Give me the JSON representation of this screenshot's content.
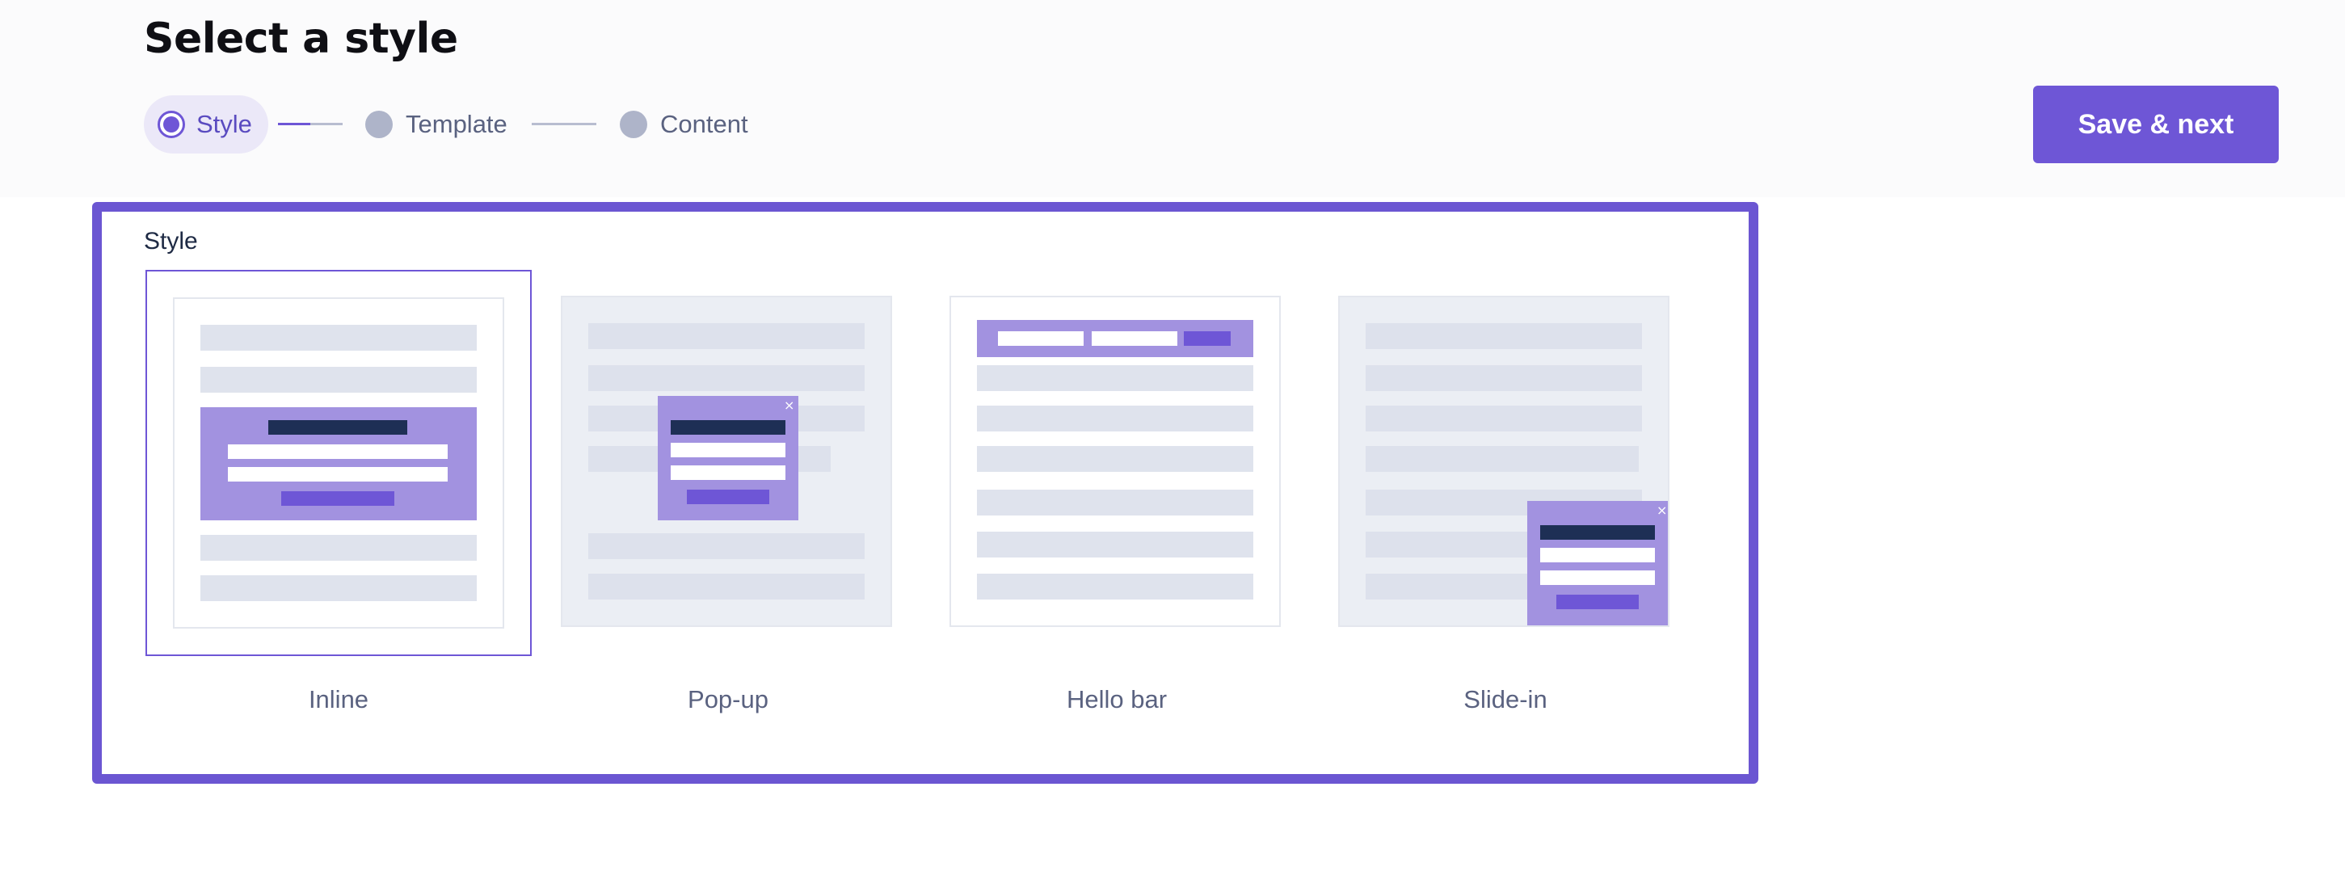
{
  "page": {
    "title": "Select a style"
  },
  "stepper": {
    "steps": [
      {
        "label": "Style",
        "state": "active"
      },
      {
        "label": "Template",
        "state": "upcoming"
      },
      {
        "label": "Content",
        "state": "upcoming"
      }
    ]
  },
  "actions": {
    "save_label": "Save & next"
  },
  "style_section": {
    "label": "Style",
    "selected": "Inline",
    "options": [
      {
        "label": "Inline"
      },
      {
        "label": "Pop-up"
      },
      {
        "label": "Hello bar"
      },
      {
        "label": "Slide-in"
      }
    ]
  },
  "colors": {
    "accent": "#6e56d6",
    "form_fill": "#a292e0",
    "form_title": "#1e2f55",
    "skeleton": "#dfe3ed"
  }
}
